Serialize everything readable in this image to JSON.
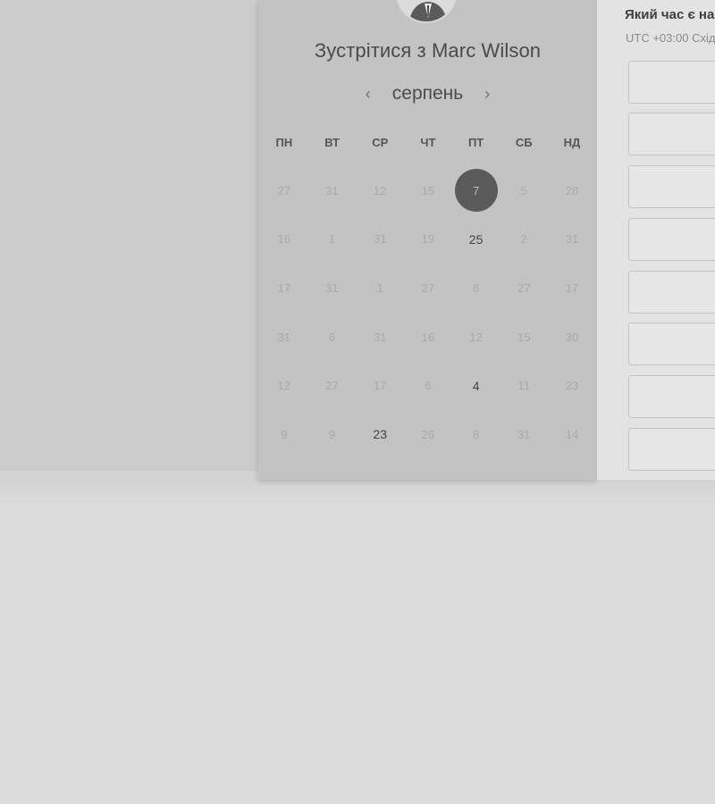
{
  "meeting": {
    "title": "Зустрітися з Marc Wilson"
  },
  "calendar": {
    "prev_icon": "‹",
    "next_icon": "›",
    "month": "серпень",
    "weekdays": [
      "ПН",
      "ВТ",
      "СР",
      "ЧТ",
      "ПТ",
      "СБ",
      "НД"
    ],
    "weeks": [
      [
        {
          "day": "27"
        },
        {
          "day": "31"
        },
        {
          "day": "12"
        },
        {
          "day": "15"
        },
        {
          "day": "7",
          "state": "selected"
        },
        {
          "day": "5"
        },
        {
          "day": "28"
        }
      ],
      [
        {
          "day": "16"
        },
        {
          "day": "1"
        },
        {
          "day": "31"
        },
        {
          "day": "19"
        },
        {
          "day": "25",
          "state": "available"
        },
        {
          "day": "2"
        },
        {
          "day": "31"
        }
      ],
      [
        {
          "day": "17"
        },
        {
          "day": "31"
        },
        {
          "day": "1"
        },
        {
          "day": "27"
        },
        {
          "day": "6"
        },
        {
          "day": "27"
        },
        {
          "day": "17"
        }
      ],
      [
        {
          "day": "31"
        },
        {
          "day": "6"
        },
        {
          "day": "31"
        },
        {
          "day": "16"
        },
        {
          "day": "12"
        },
        {
          "day": "15"
        },
        {
          "day": "30"
        }
      ],
      [
        {
          "day": "12"
        },
        {
          "day": "27"
        },
        {
          "day": "17"
        },
        {
          "day": "6"
        },
        {
          "day": "4",
          "state": "available"
        },
        {
          "day": "11"
        },
        {
          "day": "23"
        }
      ],
      [
        {
          "day": "9"
        },
        {
          "day": "9"
        },
        {
          "day": "23",
          "state": "available"
        },
        {
          "day": "26"
        },
        {
          "day": "8"
        },
        {
          "day": "31"
        },
        {
          "day": "14"
        }
      ]
    ]
  },
  "time_panel": {
    "question": "Який час є на",
    "timezone": "UTC +03:00 Схід"
  },
  "time_slots": [
    "",
    "",
    "",
    "",
    "",
    "",
    "",
    ""
  ]
}
